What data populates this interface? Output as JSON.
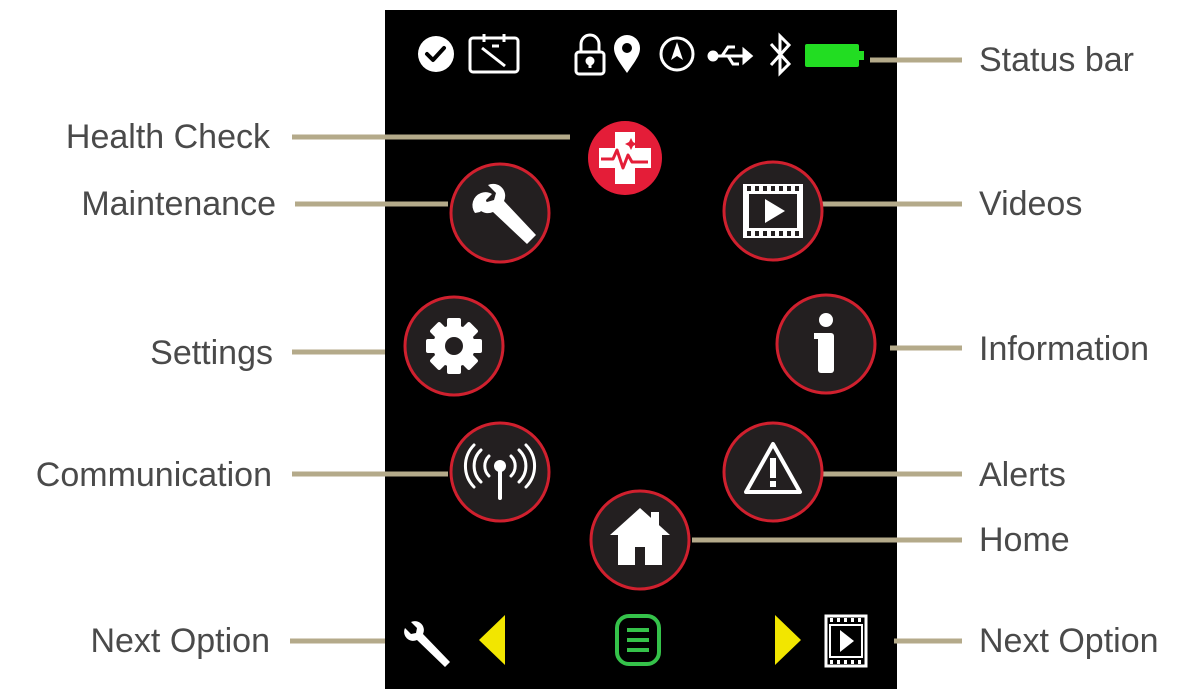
{
  "callouts": {
    "status_bar": "Status bar",
    "health_check": "Health Check",
    "maintenance": "Maintenance",
    "videos": "Videos",
    "settings": "Settings",
    "information": "Information",
    "communication": "Communication",
    "alerts": "Alerts",
    "home": "Home",
    "next_option_left": "Next Option",
    "next_option_right": "Next Option"
  },
  "colors": {
    "screen_bg": "#000000",
    "button_ring": "#d0202e",
    "button_fill": "#231f20",
    "health_fill": "#e41d38",
    "leader_line": "#b4aa8a",
    "battery": "#22dd22",
    "arrow": "#f2e600",
    "menu": "#35c24a"
  },
  "status_icons": [
    "check-icon",
    "calibration-icon",
    "lock-icon",
    "location-pin-icon",
    "compass-icon",
    "usb-icon",
    "bluetooth-icon",
    "battery-icon"
  ]
}
